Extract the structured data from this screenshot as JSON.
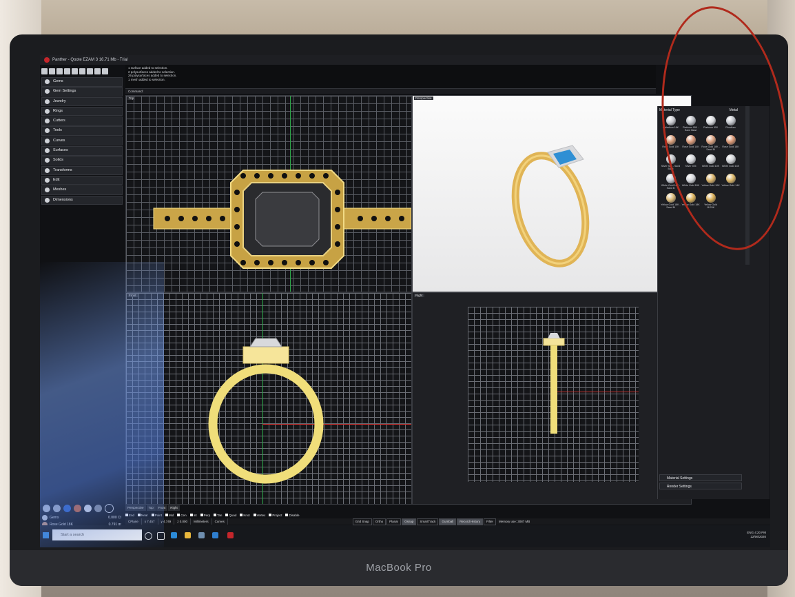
{
  "window": {
    "title": "Panther - Qoote EZAM 3 16.71 Mb - Trial"
  },
  "sidebar": {
    "items": [
      {
        "label": "Gems"
      },
      {
        "label": "Gem Settings"
      },
      {
        "label": "Jewelry"
      },
      {
        "label": "Rings"
      },
      {
        "label": "Cutters"
      },
      {
        "label": "Tools"
      },
      {
        "label": "Curves"
      },
      {
        "label": "Surfaces"
      },
      {
        "label": "Solids"
      },
      {
        "label": "Transforms"
      },
      {
        "label": "Edit"
      },
      {
        "label": "Meshes"
      },
      {
        "label": "Dimensions"
      }
    ]
  },
  "command": {
    "history": [
      "1 surface added to selection.",
      "2 polysurfaces added to selection.",
      "26 polysurfaces added to selection.",
      "1 mesh added to selection."
    ],
    "prompt": "Command:"
  },
  "viewports": {
    "top": "Top",
    "perspective": "Perspective",
    "front": "Front",
    "right": "Right"
  },
  "materials": {
    "header_label": "Material Type",
    "header_value": "Metal",
    "items": [
      {
        "label": "Palladium 18K",
        "color": "#c9cbd0"
      },
      {
        "label": "Platinum 950 - Sand Blast",
        "color": "#b9bcc2"
      },
      {
        "label": "Platinum 950",
        "color": "#d7d9dd"
      },
      {
        "label": "Rhodium",
        "color": "#c2c5cb"
      },
      {
        "label": "Rose Gold 10K",
        "color": "#d49b78"
      },
      {
        "label": "Rose Gold 14K",
        "color": "#d89878"
      },
      {
        "label": "Rose Gold 18K - Sand Bl",
        "color": "#d9a07f"
      },
      {
        "label": "Rose Gold 18K",
        "color": "#d79572"
      },
      {
        "label": "Silver 925 - Sand Blast",
        "color": "#bfc1c6"
      },
      {
        "label": "Silver 925",
        "color": "#d4d6da"
      },
      {
        "label": "White Gold 10K",
        "color": "#d0d2d6"
      },
      {
        "label": "White Gold 14K",
        "color": "#cfd1d5"
      },
      {
        "label": "White Gold 18K - Sand B",
        "color": "#c3c5ca"
      },
      {
        "label": "White Gold 18K",
        "color": "#d5d7db"
      },
      {
        "label": "Yellow Gold 10K",
        "color": "#d9b36a"
      },
      {
        "label": "Yellow Gold 14K",
        "color": "#dcb768"
      },
      {
        "label": "Yellow Gold 18K - Sand Bl",
        "color": "#d9b978"
      },
      {
        "label": "Yellow Gold 18K",
        "color": "#dcb35c"
      },
      {
        "label": "Yellow Gold 18.25K",
        "color": "#d8ad56"
      }
    ],
    "material_settings": "Material Settings",
    "render_settings": "Render Settings"
  },
  "bottom": {
    "gems_label": "Gems",
    "gems_value": "0.000 Ct",
    "metal_label": "Rose Gold 18K",
    "metal_value": "0.791 gr"
  },
  "view_tabs": [
    "Perspective",
    "Top",
    "Front",
    "Right"
  ],
  "osnaps": [
    "End",
    "Near",
    "Point",
    "Mid",
    "Cen",
    "Int",
    "Perp",
    "Tan",
    "Quad",
    "Knot",
    "Vertex",
    "Project",
    "Disable"
  ],
  "status": {
    "cplane": "CPlane",
    "x": "x 7.457",
    "y": "y 4.749",
    "z": "z 0.000",
    "units": "Millimeters",
    "layer": "Curves",
    "buttons": [
      "Grid Snap",
      "Ortho",
      "Planar",
      "Osnap",
      "SmartTrack",
      "Gumball",
      "Record History",
      "Filter"
    ],
    "memory": "Memory use: 3087 MB"
  },
  "taskbar": {
    "search_placeholder": "Start a search",
    "time": "4:20 PM",
    "date": "22/06/2020",
    "lang": "ENG"
  },
  "device": {
    "brand": "MacBook Pro"
  }
}
